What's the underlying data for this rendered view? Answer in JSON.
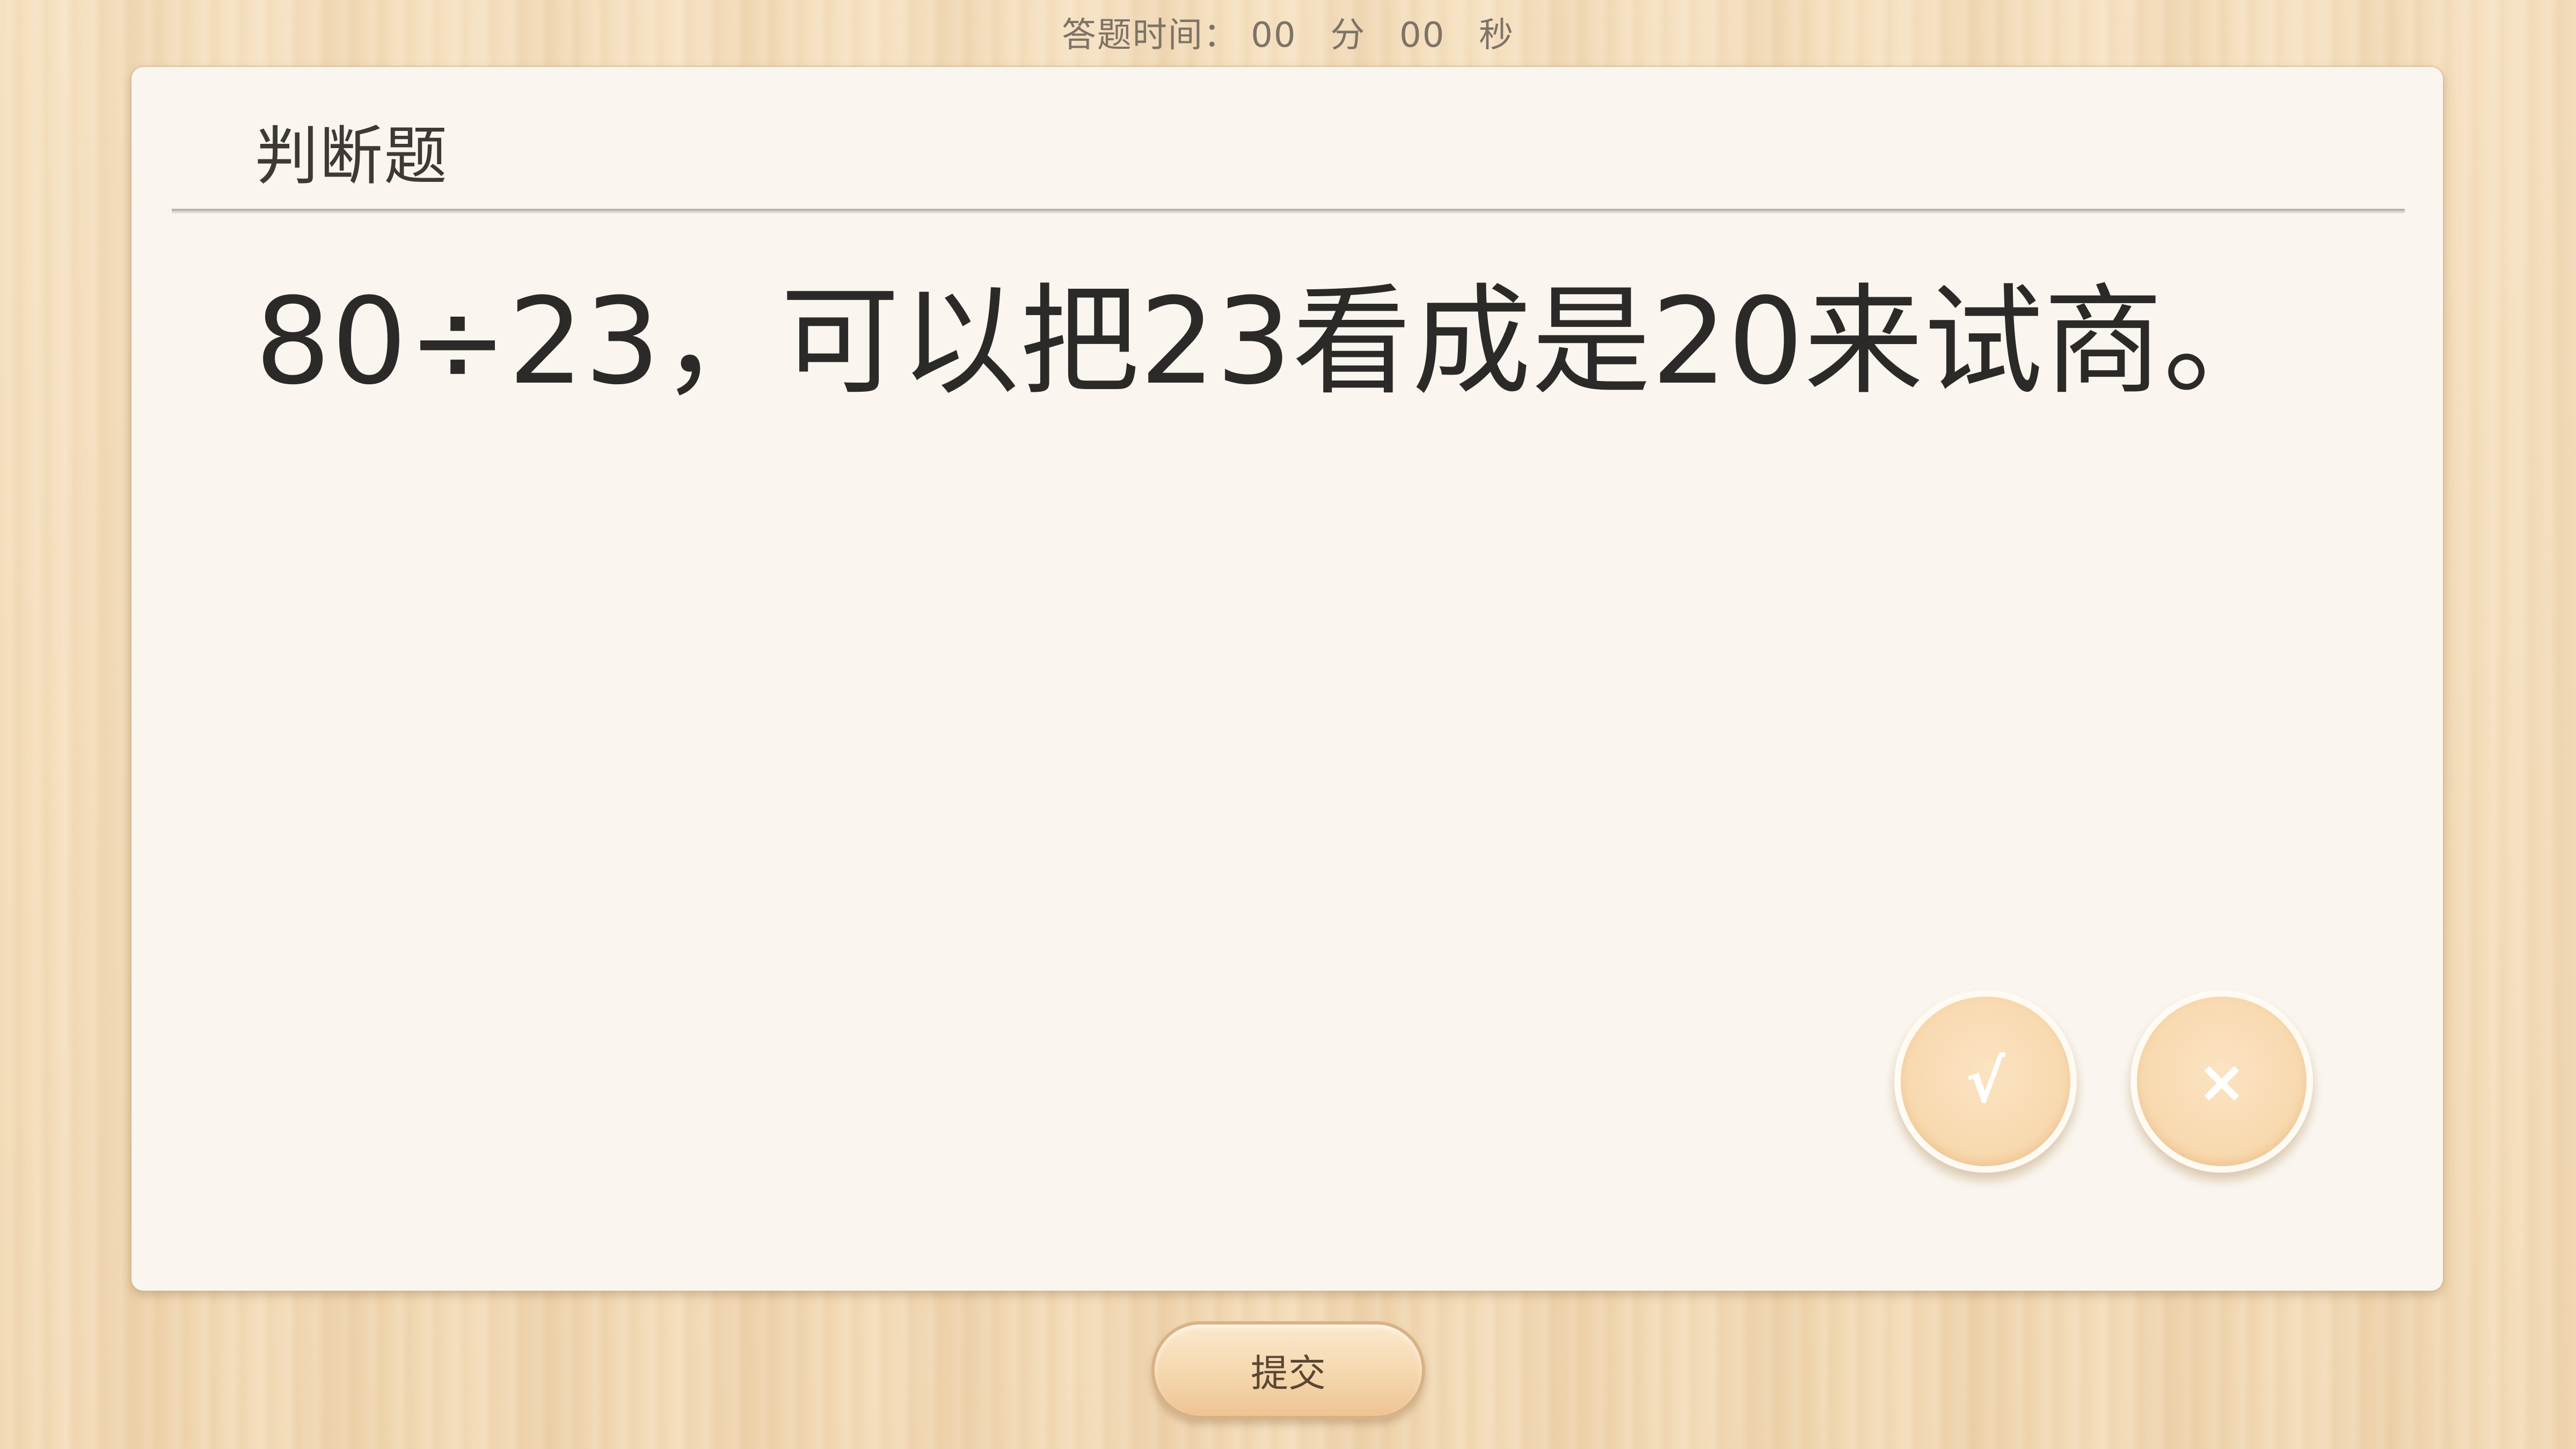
{
  "timer": {
    "label": "答题时间：",
    "minutes": "00",
    "minutes_unit": "分",
    "seconds": "00",
    "seconds_unit": "秒"
  },
  "card": {
    "header": "判断题",
    "question": "80÷23，可以把23看成是20来试商。"
  },
  "answers": {
    "true_symbol": "√",
    "false_symbol": "×"
  },
  "submit": {
    "label": "提交"
  }
}
